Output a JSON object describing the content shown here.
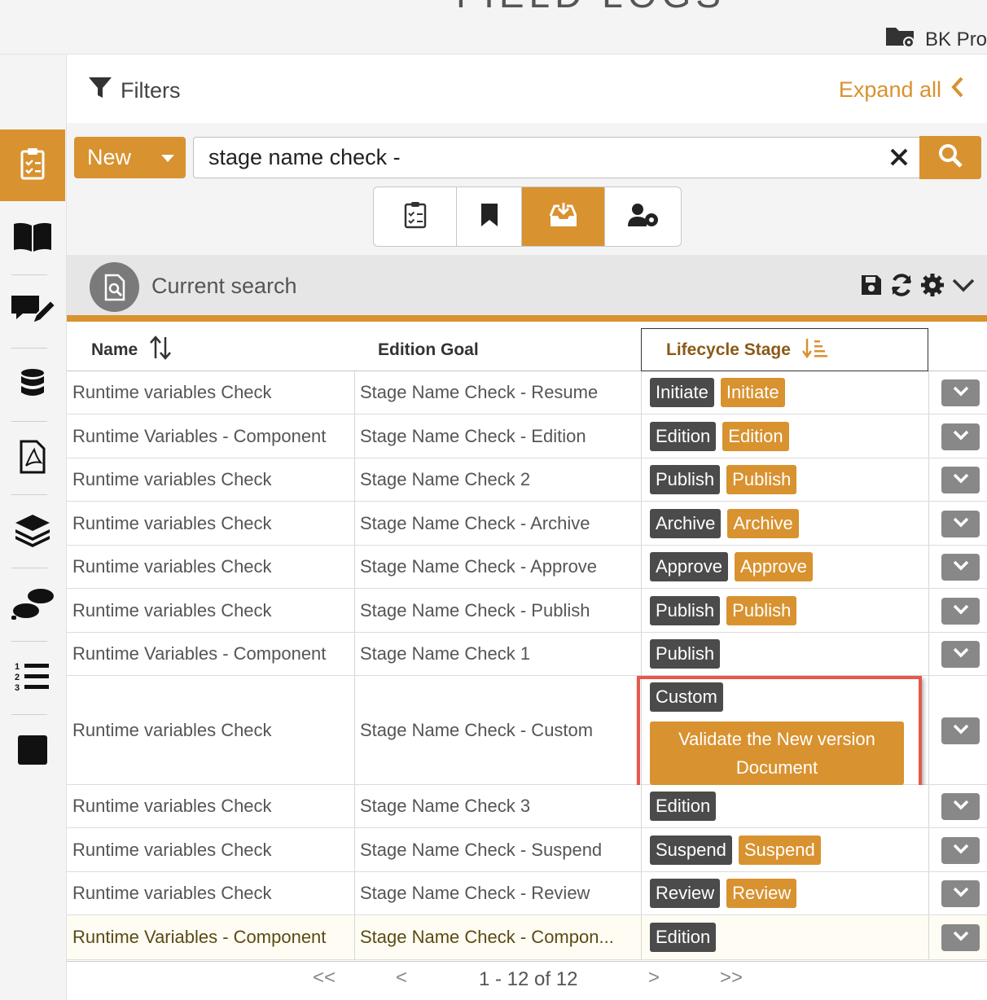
{
  "header": {
    "app_title_partial": "FIELD LOGS",
    "project_label": "BK Pro"
  },
  "sidebar": {
    "items": [
      {
        "icon": "clipboard-check-icon",
        "active": true
      },
      {
        "icon": "book-open-icon",
        "active": false
      },
      {
        "icon": "comments-edit-icon",
        "active": false
      },
      {
        "icon": "database-icon",
        "active": false
      },
      {
        "icon": "pdf-file-icon",
        "active": false
      },
      {
        "icon": "layers-icon",
        "active": false
      },
      {
        "icon": "footsteps-icon",
        "active": false
      },
      {
        "icon": "numbered-list-icon",
        "active": false
      },
      {
        "icon": "stop-square-icon",
        "active": false
      }
    ]
  },
  "filters": {
    "title": "Filters",
    "expand_label": "Expand all"
  },
  "toolbar": {
    "new_label": "New",
    "search_value": "stage name check -",
    "views": [
      {
        "icon": "clipboard-check-icon",
        "active": false
      },
      {
        "icon": "bookmark-icon",
        "active": false
      },
      {
        "icon": "inbox-download-icon",
        "active": true
      },
      {
        "icon": "user-gear-icon",
        "active": false
      }
    ]
  },
  "current_search": {
    "title": "Current search"
  },
  "table": {
    "columns": [
      "Name",
      "Edition Goal",
      "Lifecycle Stage"
    ],
    "sorted_column": "Lifecycle Stage",
    "rows": [
      {
        "name": "Runtime variables Check",
        "goal": "Stage Name Check - Resume",
        "dark": "Initiate",
        "orange": "Initiate"
      },
      {
        "name": "Runtime Variables - Component",
        "goal": "Stage Name Check - Edition",
        "dark": "Edition",
        "orange": "Edition"
      },
      {
        "name": "Runtime variables Check",
        "goal": "Stage Name Check 2",
        "dark": "Publish",
        "orange": "Publish"
      },
      {
        "name": "Runtime variables Check",
        "goal": "Stage Name Check - Archive",
        "dark": "Archive",
        "orange": "Archive"
      },
      {
        "name": "Runtime variables Check",
        "goal": "Stage Name Check - Approve",
        "dark": "Approve",
        "orange": "Approve"
      },
      {
        "name": "Runtime variables Check",
        "goal": "Stage Name Check - Publish",
        "dark": "Publish",
        "orange": "Publish"
      },
      {
        "name": "Runtime Variables - Component",
        "goal": "Stage Name Check 1",
        "dark": "Publish",
        "orange": ""
      },
      {
        "name": "Runtime variables Check",
        "goal": "Stage Name Check - Custom",
        "dark": "Custom",
        "orange_line1": "Validate the New version",
        "orange_line2": "Document"
      },
      {
        "name": "Runtime variables Check",
        "goal": "Stage Name Check 3",
        "dark": "Edition",
        "orange": ""
      },
      {
        "name": "Runtime variables Check",
        "goal": "Stage Name Check - Suspend",
        "dark": "Suspend",
        "orange": "Suspend"
      },
      {
        "name": "Runtime variables Check",
        "goal": "Stage Name Check - Review",
        "dark": "Review",
        "orange": "Review"
      },
      {
        "name": "Runtime Variables - Component",
        "goal": "Stage Name Check - Compon...",
        "dark": "Edition",
        "orange": ""
      }
    ]
  },
  "pagination": {
    "first": "<<",
    "prev": "<",
    "info": "1 - 12 of 12",
    "next": ">",
    "last": ">>"
  },
  "colors": {
    "accent": "#d8922f",
    "dark_badge": "#4b4b4b",
    "highlight_box": "#e5594b"
  }
}
